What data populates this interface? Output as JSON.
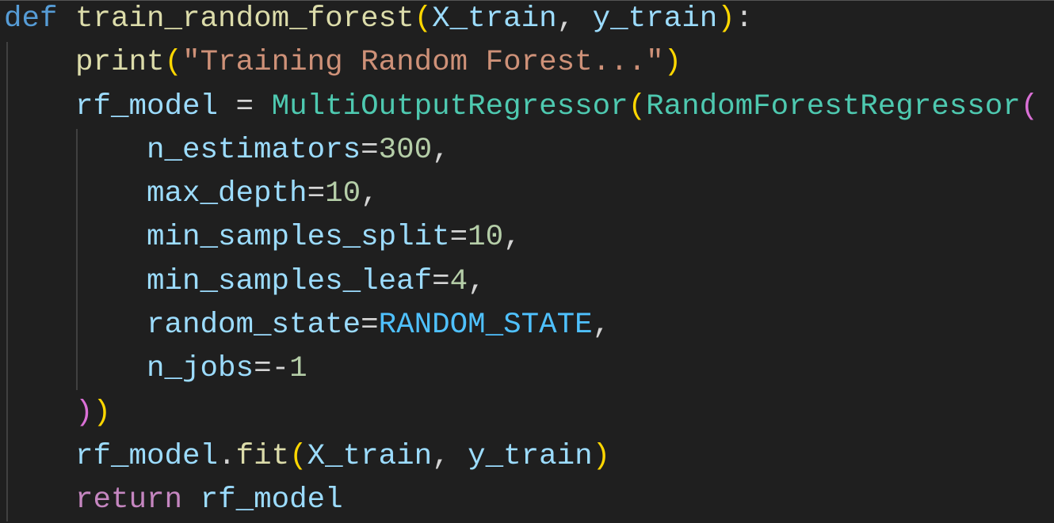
{
  "code_lines": [
    [
      [
        "kw",
        "def"
      ],
      [
        "op",
        " "
      ],
      [
        "fn",
        "train_random_forest"
      ],
      [
        "b1",
        "("
      ],
      [
        "var",
        "X_train"
      ],
      [
        "op",
        ", "
      ],
      [
        "var",
        "y_train"
      ],
      [
        "b1",
        ")"
      ],
      [
        "op",
        ":"
      ]
    ],
    [
      [
        "op",
        "    "
      ],
      [
        "fn",
        "print"
      ],
      [
        "b1",
        "("
      ],
      [
        "str",
        "\"Training Random Forest...\""
      ],
      [
        "b1",
        ")"
      ]
    ],
    [
      [
        "op",
        "    "
      ],
      [
        "var",
        "rf_model"
      ],
      [
        "op",
        " = "
      ],
      [
        "cls",
        "MultiOutputRegressor"
      ],
      [
        "b1",
        "("
      ],
      [
        "cls",
        "RandomForestRegressor"
      ],
      [
        "b2",
        "("
      ]
    ],
    [
      [
        "op",
        "        "
      ],
      [
        "var",
        "n_estimators"
      ],
      [
        "op",
        "="
      ],
      [
        "num",
        "300"
      ],
      [
        "op",
        ","
      ]
    ],
    [
      [
        "op",
        "        "
      ],
      [
        "var",
        "max_depth"
      ],
      [
        "op",
        "="
      ],
      [
        "num",
        "10"
      ],
      [
        "op",
        ","
      ]
    ],
    [
      [
        "op",
        "        "
      ],
      [
        "var",
        "min_samples_split"
      ],
      [
        "op",
        "="
      ],
      [
        "num",
        "10"
      ],
      [
        "op",
        ","
      ]
    ],
    [
      [
        "op",
        "        "
      ],
      [
        "var",
        "min_samples_leaf"
      ],
      [
        "op",
        "="
      ],
      [
        "num",
        "4"
      ],
      [
        "op",
        ","
      ]
    ],
    [
      [
        "op",
        "        "
      ],
      [
        "var",
        "random_state"
      ],
      [
        "op",
        "="
      ],
      [
        "const",
        "RANDOM_STATE"
      ],
      [
        "op",
        ","
      ]
    ],
    [
      [
        "op",
        "        "
      ],
      [
        "var",
        "n_jobs"
      ],
      [
        "op",
        "=-"
      ],
      [
        "num",
        "1"
      ]
    ],
    [
      [
        "op",
        "    "
      ],
      [
        "b2",
        ")"
      ],
      [
        "b1",
        ")"
      ]
    ],
    [
      [
        "op",
        "    "
      ],
      [
        "var",
        "rf_model"
      ],
      [
        "op",
        "."
      ],
      [
        "fn",
        "fit"
      ],
      [
        "b1",
        "("
      ],
      [
        "var",
        "X_train"
      ],
      [
        "op",
        ", "
      ],
      [
        "var",
        "y_train"
      ],
      [
        "b1",
        ")"
      ]
    ],
    [
      [
        "op",
        "    "
      ],
      [
        "ctl",
        "return"
      ],
      [
        "op",
        " "
      ],
      [
        "var",
        "rf_model"
      ]
    ]
  ]
}
